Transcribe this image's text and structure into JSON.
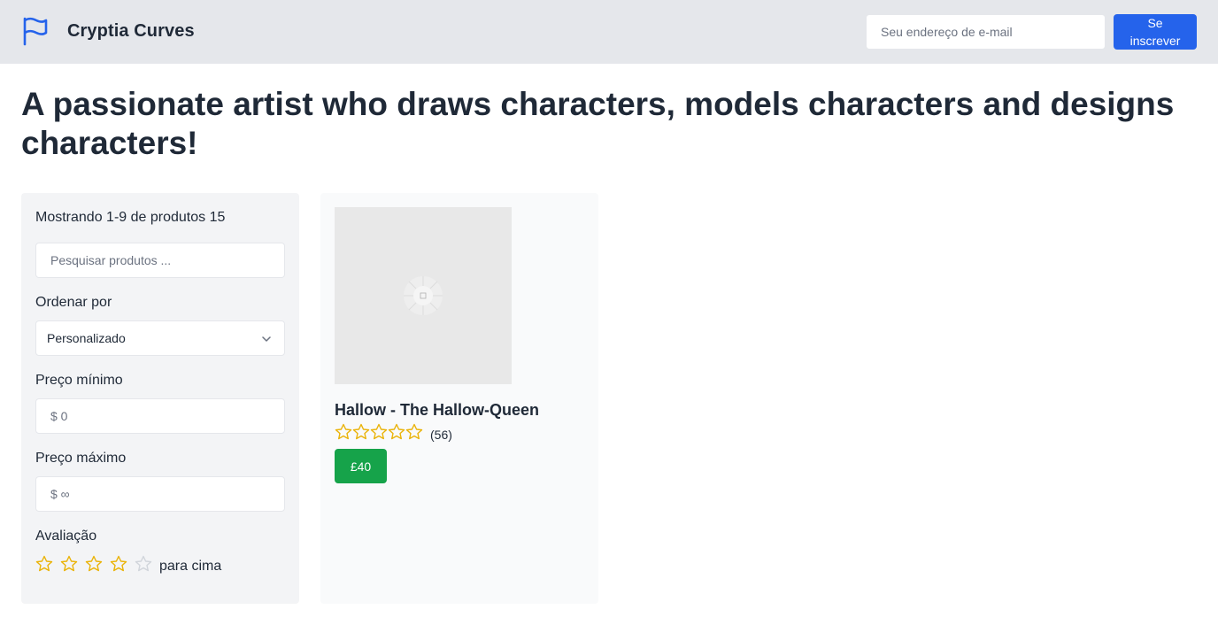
{
  "header": {
    "brand_name": "Cryptia Curves",
    "email_placeholder": "Seu endereço de e-mail",
    "subscribe_label": "Se inscrever"
  },
  "headline": "A passionate artist who draws characters, models characters and designs characters!",
  "filters": {
    "count_text": "Mostrando 1-9 de produtos 15",
    "search_placeholder": "Pesquisar produtos ...",
    "sort_label": "Ordenar por",
    "sort_value": "Personalizado",
    "min_price_label": "Preço mínimo",
    "min_price_placeholder": "$ 0",
    "max_price_label": "Preço máximo",
    "max_price_placeholder": "$ ∞",
    "rating_label": "Avaliação",
    "rating_min_stars": 4,
    "rating_max_stars": 5,
    "rating_suffix": "para cima"
  },
  "products": [
    {
      "title": "Hallow - The Hallow-Queen",
      "rating": 0,
      "reviews": "(56)",
      "price": "£40"
    }
  ],
  "colors": {
    "header_bg": "#e5e7eb",
    "accent_blue": "#2563eb",
    "price_green": "#16a34a",
    "star_gold": "#eab308",
    "star_empty": "#d1d5db"
  },
  "icons": {
    "brand": "flag-icon",
    "sort": "chevron-down-icon",
    "image_placeholder": "image-placeholder-icon",
    "rating": "star-icon"
  }
}
